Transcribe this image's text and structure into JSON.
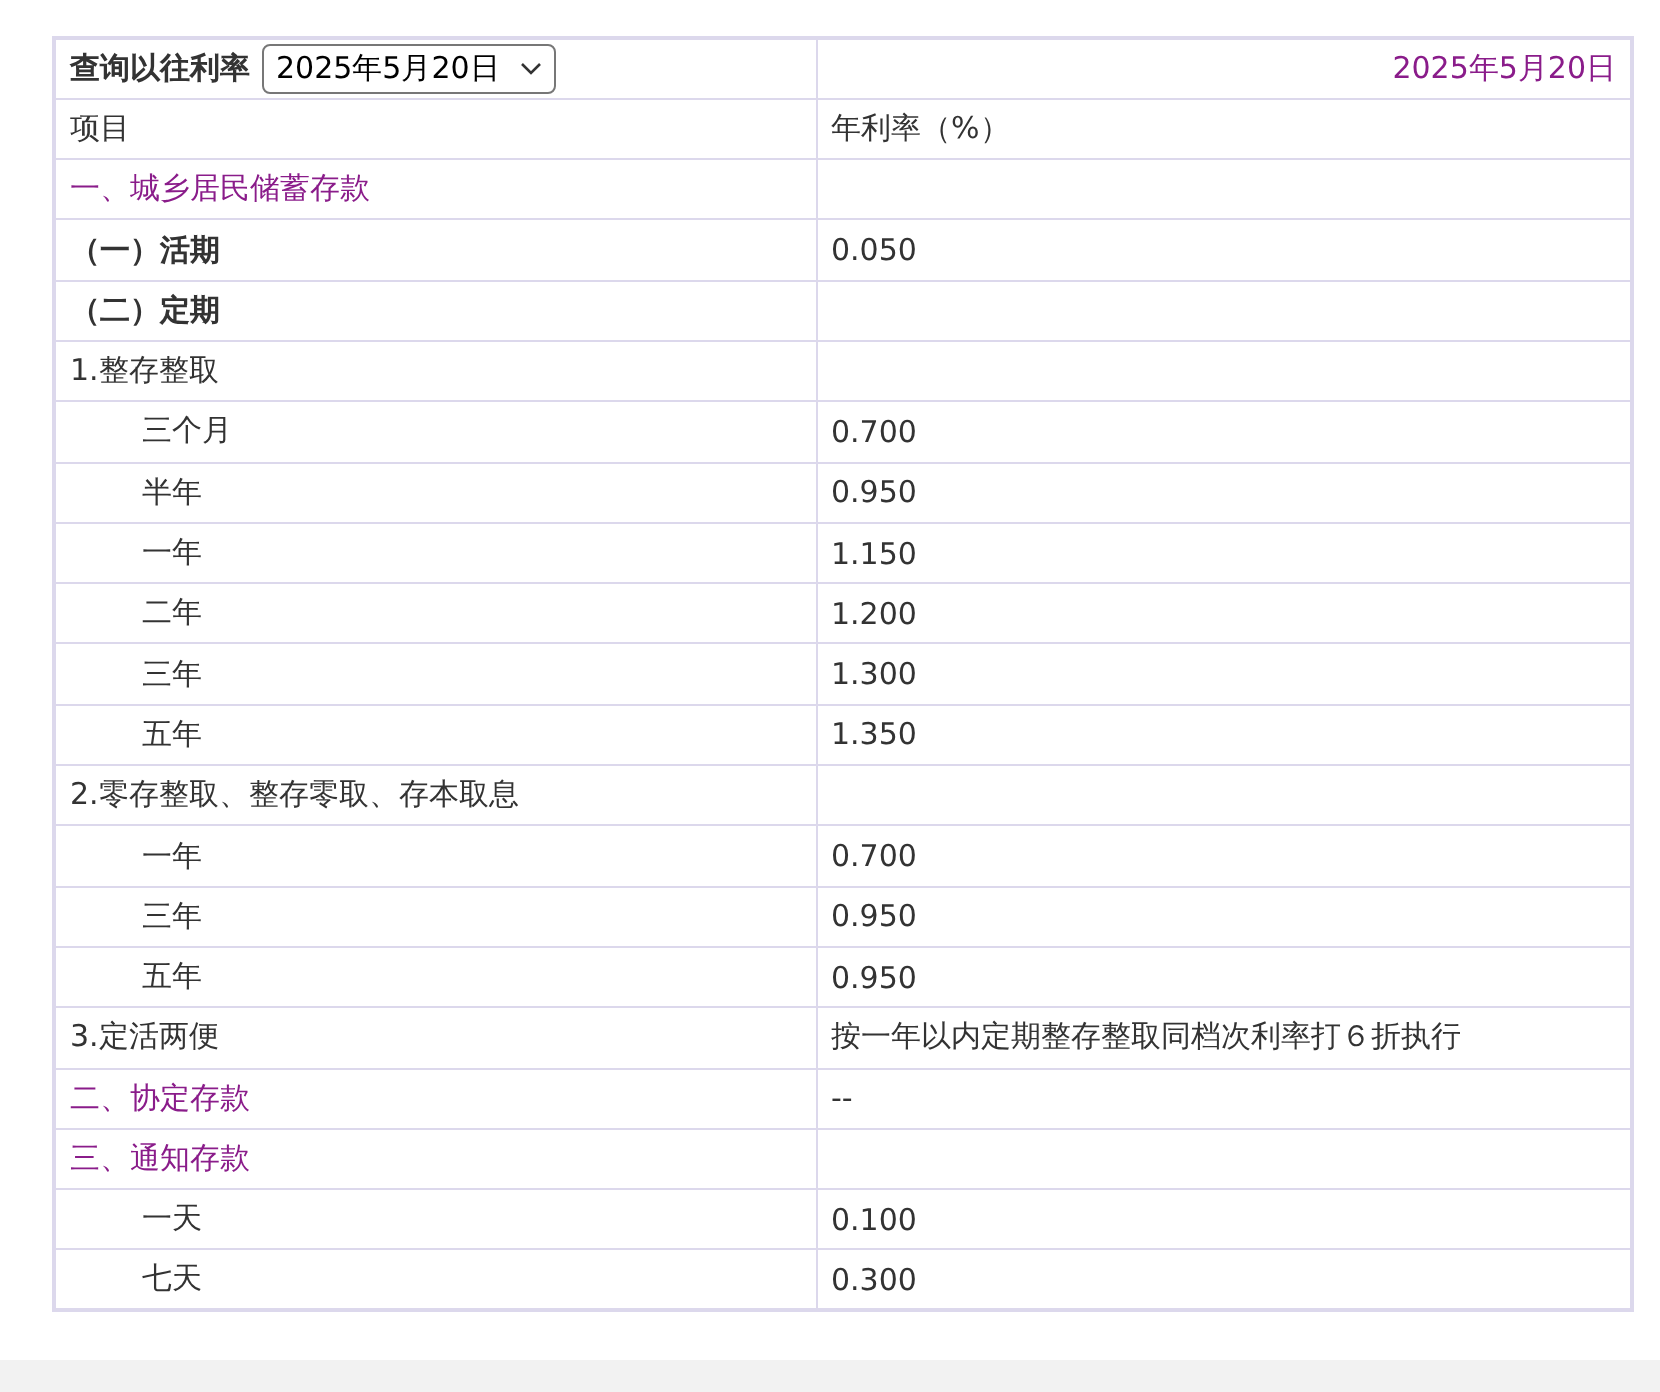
{
  "query": {
    "label": "查询以往利率",
    "selected_date": "2025年5月20日",
    "shown_date": "2025年5月20日"
  },
  "columns": [
    "项目",
    "年利率（%）"
  ],
  "rows": [
    {
      "kind": "section",
      "item": "一、城乡居民储蓄存款",
      "rate": ""
    },
    {
      "kind": "subsection",
      "item": "（一）活期",
      "rate": "0.050"
    },
    {
      "kind": "subsection",
      "item": "（二）定期",
      "rate": ""
    },
    {
      "kind": "group",
      "item": "1.整存整取",
      "rate": ""
    },
    {
      "kind": "term",
      "item": "三个月",
      "rate": "0.700"
    },
    {
      "kind": "term",
      "item": "半年",
      "rate": "0.950"
    },
    {
      "kind": "term",
      "item": "一年",
      "rate": "1.150"
    },
    {
      "kind": "term",
      "item": "二年",
      "rate": "1.200"
    },
    {
      "kind": "term",
      "item": "三年",
      "rate": "1.300"
    },
    {
      "kind": "term",
      "item": "五年",
      "rate": "1.350"
    },
    {
      "kind": "group",
      "item": "2.零存整取、整存零取、存本取息",
      "rate": ""
    },
    {
      "kind": "term",
      "item": "一年",
      "rate": "0.700"
    },
    {
      "kind": "term",
      "item": "三年",
      "rate": "0.950"
    },
    {
      "kind": "term",
      "item": "五年",
      "rate": "0.950"
    },
    {
      "kind": "group",
      "item": "3.定活两便",
      "rate": "按一年以内定期整存整取同档次利率打６折执行"
    },
    {
      "kind": "section",
      "item": "二、协定存款",
      "rate": "--"
    },
    {
      "kind": "section",
      "item": "三、通知存款",
      "rate": ""
    },
    {
      "kind": "term",
      "item": "一天",
      "rate": "0.100"
    },
    {
      "kind": "term",
      "item": "七天",
      "rate": "0.300"
    }
  ]
}
